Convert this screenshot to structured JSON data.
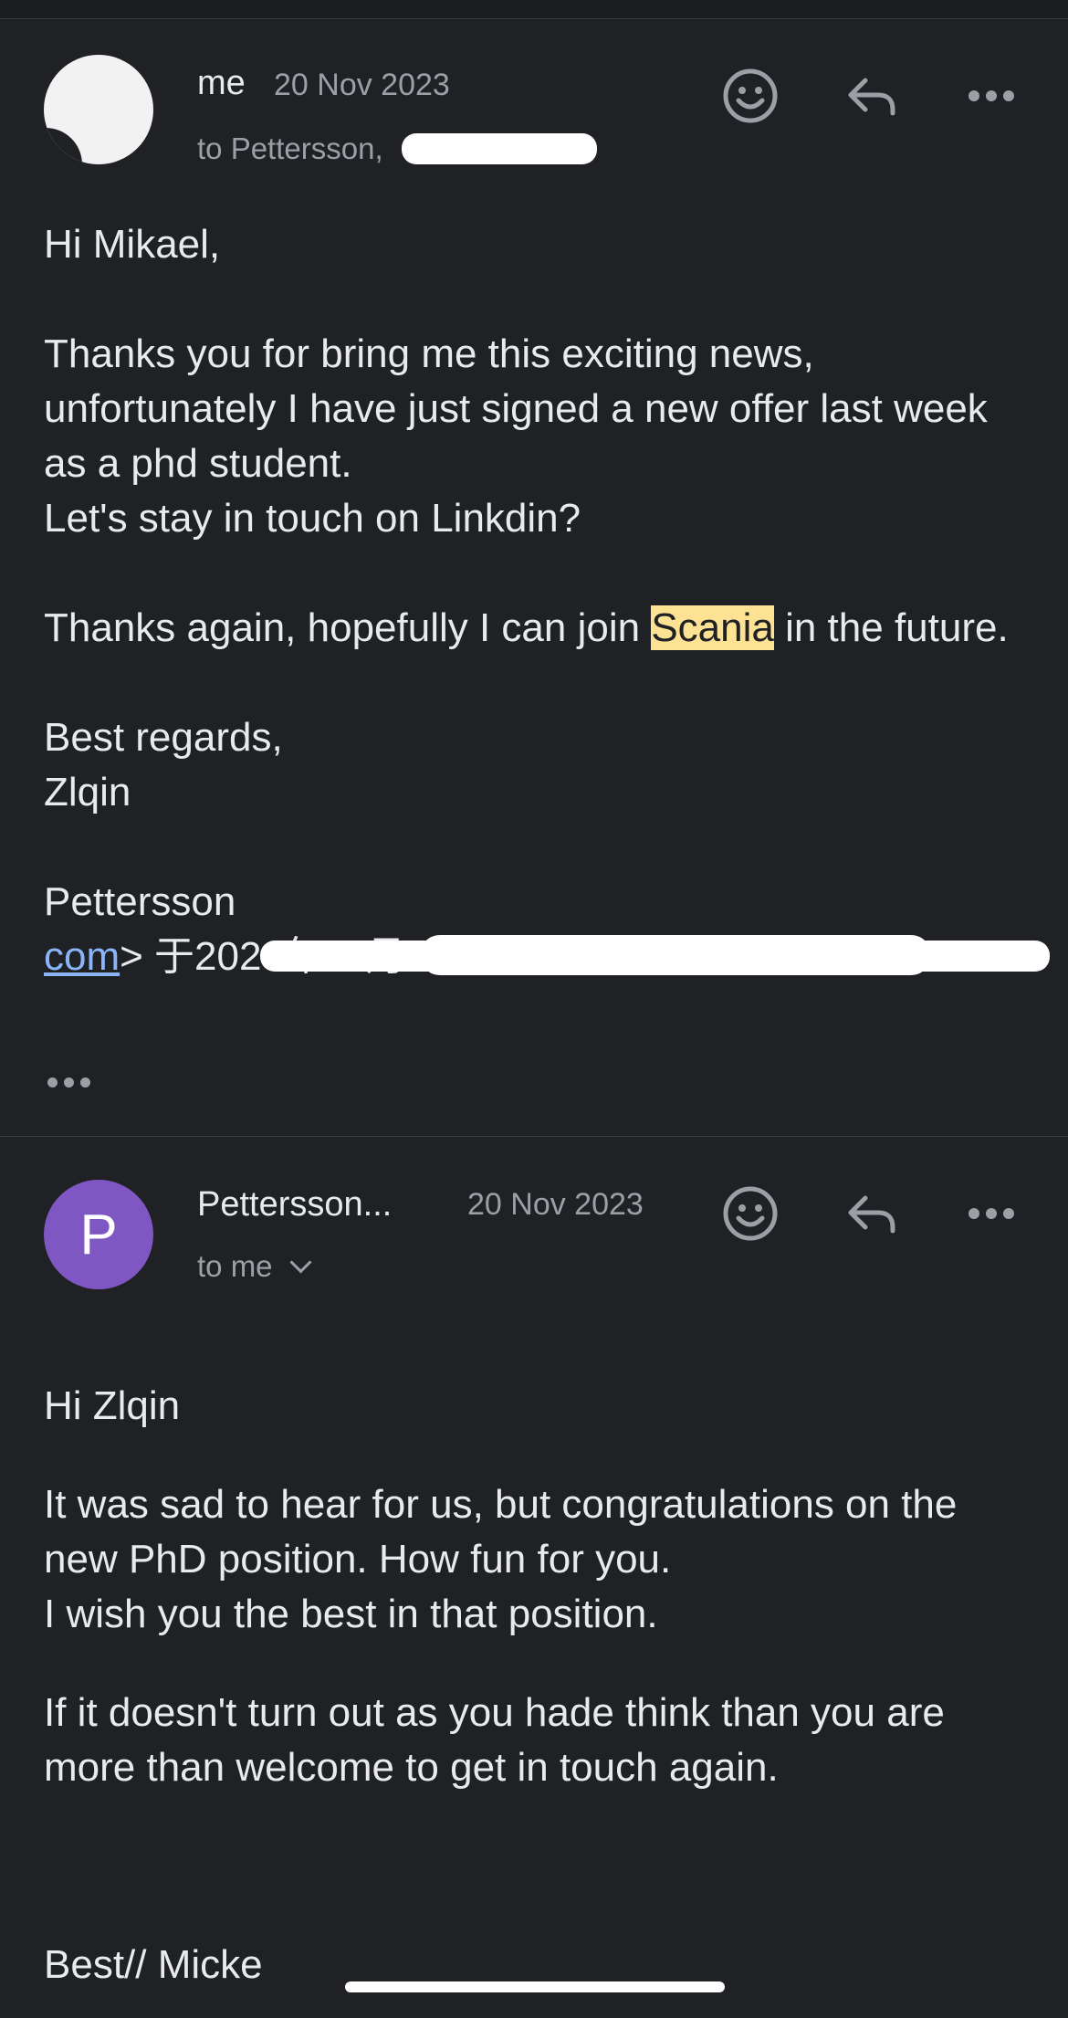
{
  "messages": [
    {
      "sender": "me",
      "date": "20 Nov 2023",
      "recipient": "to Pettersson,",
      "greeting": "Hi Mikael,",
      "paragraph_1": "Thanks you for bring me this exciting news, unfortunately I have just signed a new offer last week as a phd student.\nLet's stay in touch on Linkdin?",
      "thanks_before": "Thanks again, hopefully I can join ",
      "thanks_highlight": "Scania",
      "thanks_after": " in the future.",
      "signoff": "Best regards,\nZlqin",
      "quote_name": "Pettersson ",
      "quote_link": "com",
      "quote_rest": "> 于2023年11月16日周四 09:20写道："
    },
    {
      "sender": "Pettersson...",
      "avatar_initial": "P",
      "date": "20 Nov 2023",
      "recipient": "to me",
      "greeting": "Hi Zlqin",
      "paragraph_1": "It was sad to hear for us, but congratulations on the new PhD position. How fun for you.\nI wish you the best in that position.",
      "paragraph_2": "If it doesn't turn out as you hade think than you are more than welcome to get in touch again.",
      "signoff": "Best// Micke"
    }
  ],
  "icons": {
    "react": "smiley-icon",
    "reply": "reply-icon",
    "more": "more-icon",
    "expand": "chevron-down-icon",
    "collapsed_quote": "ellipsis-icon"
  },
  "colors": {
    "background": "#202124",
    "avatar_p": "#7e57c2",
    "highlight": "#fde293",
    "link": "#8ab4f8"
  }
}
